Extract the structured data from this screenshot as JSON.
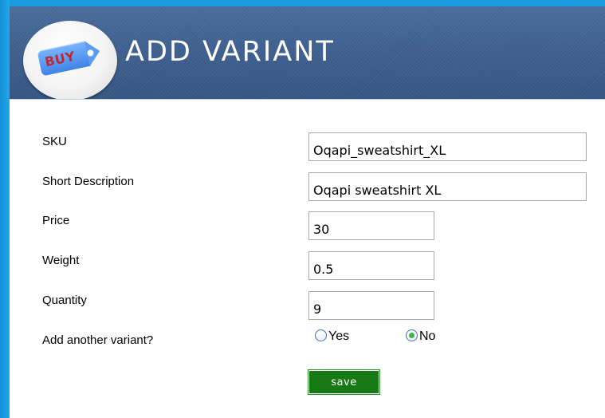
{
  "header": {
    "logo_text": "BUY",
    "title": "ADD VARIANT"
  },
  "form": {
    "sku_label": "SKU",
    "sku_value": "Oqapi_sweatshirt_XL",
    "short_description_label": "Short Description",
    "short_description_value": "Oqapi sweatshirt XL",
    "price_label": "Price",
    "price_value": "30",
    "weight_label": "Weight",
    "weight_value": "0.5",
    "quantity_label": "Quantity",
    "quantity_value": "9",
    "add_another_label": "Add another variant?",
    "add_another_options": [
      "Yes",
      "No"
    ],
    "add_another_selected": "No",
    "save_label": "save"
  },
  "colors": {
    "background": "#1a9be0",
    "header": "#3e5f8e",
    "save_button": "#187a17",
    "radio_selected": "#3fb540"
  }
}
